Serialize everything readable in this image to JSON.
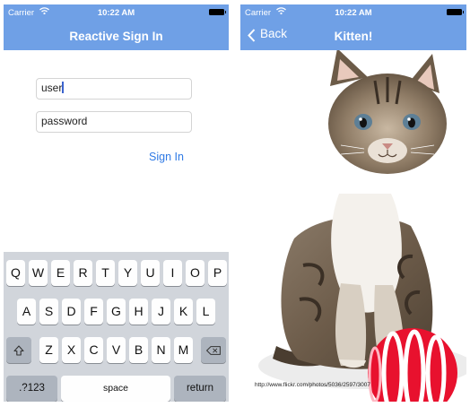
{
  "left_screen": {
    "status_bar": {
      "carrier": "Carrier",
      "time": "10:22 AM"
    },
    "nav_title": "Reactive Sign In",
    "username_field": {
      "value": "user"
    },
    "password_field": {
      "value": "password"
    },
    "sign_in_label": "Sign In",
    "keyboard": {
      "row1": [
        "Q",
        "W",
        "E",
        "R",
        "T",
        "Y",
        "U",
        "I",
        "O",
        "P"
      ],
      "row2": [
        "A",
        "S",
        "D",
        "F",
        "G",
        "H",
        "J",
        "K",
        "L"
      ],
      "row3": [
        "Z",
        "X",
        "C",
        "V",
        "B",
        "N",
        "M"
      ],
      "numbers_key": ".?123",
      "space_key": "space",
      "return_key": "return"
    }
  },
  "right_screen": {
    "status_bar": {
      "carrier": "Carrier",
      "time": "10:22 AM"
    },
    "nav_title": "Kitten!",
    "back_label": "Back",
    "photo_caption": "http://www.flickr.com/photos/5036/2597/3007"
  },
  "colors": {
    "nav_bar": "#6fa0e6",
    "link_blue": "#2f7ae5",
    "keyboard_bg": "#d1d5db",
    "yarn_red": "#e8112e"
  }
}
